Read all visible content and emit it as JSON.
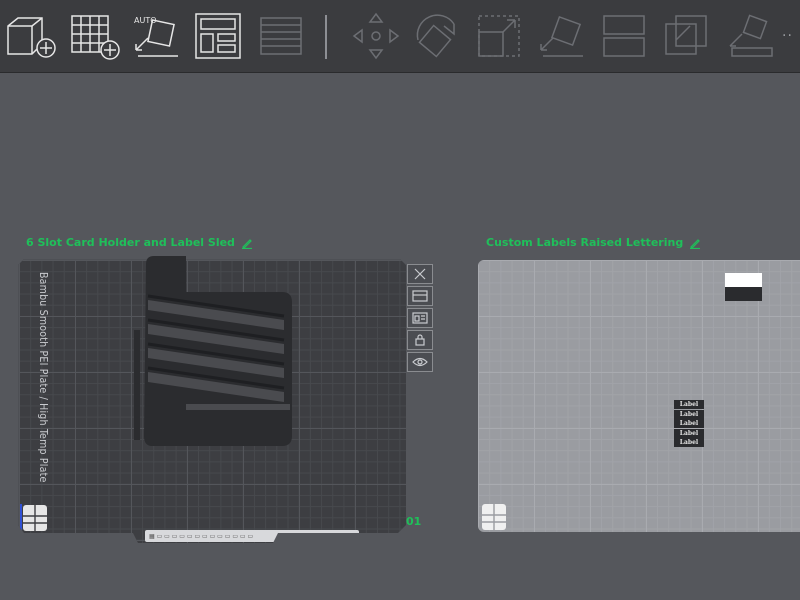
{
  "toolbar": {
    "buttons": [
      {
        "icon": "add-cube-icon",
        "enabled": true
      },
      {
        "icon": "add-plate-icon",
        "enabled": true
      },
      {
        "icon": "auto-orient-icon",
        "label": "AUTO",
        "enabled": true
      },
      {
        "icon": "arrange-icon",
        "enabled": true
      },
      {
        "icon": "layers-icon",
        "enabled": false
      },
      {
        "icon": "move-icon",
        "enabled": false
      },
      {
        "icon": "rotate-icon",
        "enabled": false
      },
      {
        "icon": "scale-icon",
        "enabled": false
      },
      {
        "icon": "lay-on-face-icon",
        "enabled": false
      },
      {
        "icon": "split-icon",
        "enabled": false
      },
      {
        "icon": "boolean-icon",
        "enabled": false
      },
      {
        "icon": "paint-icon",
        "enabled": false
      }
    ],
    "more": "··"
  },
  "plates": [
    {
      "title": "6 Slot Card Holder and Label Sled",
      "plate_name": "Bambu Smooth PEI Plate / High Temp Plate",
      "plate_number": "01",
      "side_buttons": [
        "close-icon",
        "arrange-plate-icon",
        "orient-plate-icon",
        "lock-icon",
        "eye-icon"
      ]
    },
    {
      "title": "Custom Labels Raised Lettering",
      "labels": [
        "Label",
        "Label",
        "Label",
        "Label",
        "Label"
      ]
    }
  ],
  "colors": {
    "background": "#55575c",
    "toolbar": "#3b3c3f",
    "accent_green": "#1fc05a",
    "plate_dark": "#3d3e42",
    "plate_light": "#9a9ca1"
  }
}
